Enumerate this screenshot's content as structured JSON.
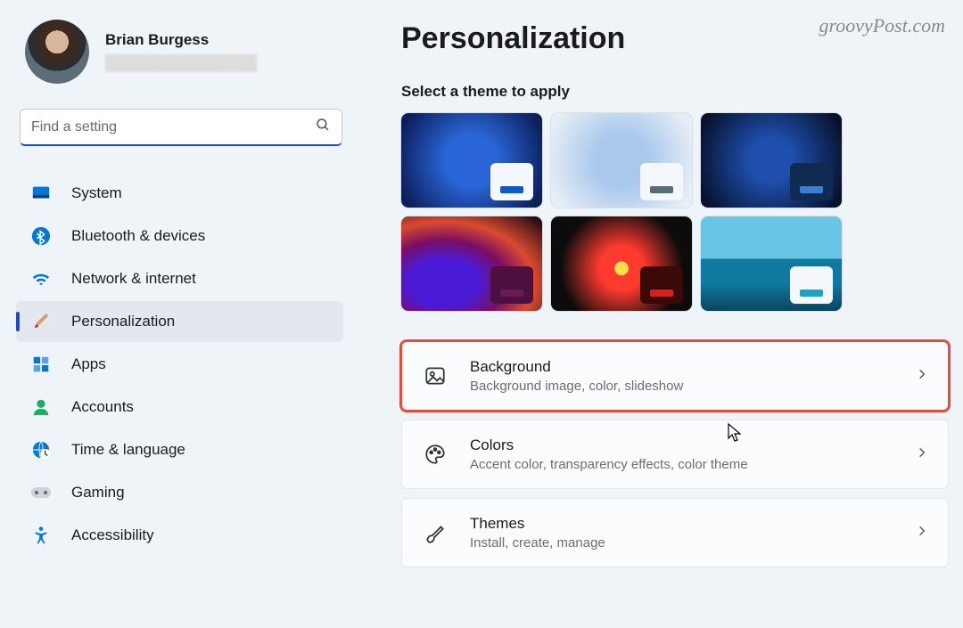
{
  "watermark": "groovyPost.com",
  "profile": {
    "name": "Brian Burgess"
  },
  "search": {
    "placeholder": "Find a setting",
    "value": ""
  },
  "sidebar": {
    "items": [
      {
        "label": "System"
      },
      {
        "label": "Bluetooth & devices"
      },
      {
        "label": "Network & internet"
      },
      {
        "label": "Personalization"
      },
      {
        "label": "Apps"
      },
      {
        "label": "Accounts"
      },
      {
        "label": "Time & language"
      },
      {
        "label": "Gaming"
      },
      {
        "label": "Accessibility"
      }
    ]
  },
  "main": {
    "title": "Personalization",
    "subheading": "Select a theme to apply",
    "themes": [
      {
        "swatch_bg": "#f4f7fb",
        "bar": "#0a5bd3"
      },
      {
        "swatch_bg": "#f4f7fb",
        "bar": "#5a6b78"
      },
      {
        "swatch_bg": "#102a52",
        "bar": "#3a7fd6"
      },
      {
        "swatch_bg": "#4d0f40",
        "bar": "#6a1a54"
      },
      {
        "swatch_bg": "#3a0908",
        "bar": "#d61f1f"
      },
      {
        "swatch_bg": "#f4f7fb",
        "bar": "#1aa3c4"
      }
    ],
    "rows": [
      {
        "title": "Background",
        "sub": "Background image, color, slideshow"
      },
      {
        "title": "Colors",
        "sub": "Accent color, transparency effects, color theme"
      },
      {
        "title": "Themes",
        "sub": "Install, create, manage"
      }
    ]
  }
}
